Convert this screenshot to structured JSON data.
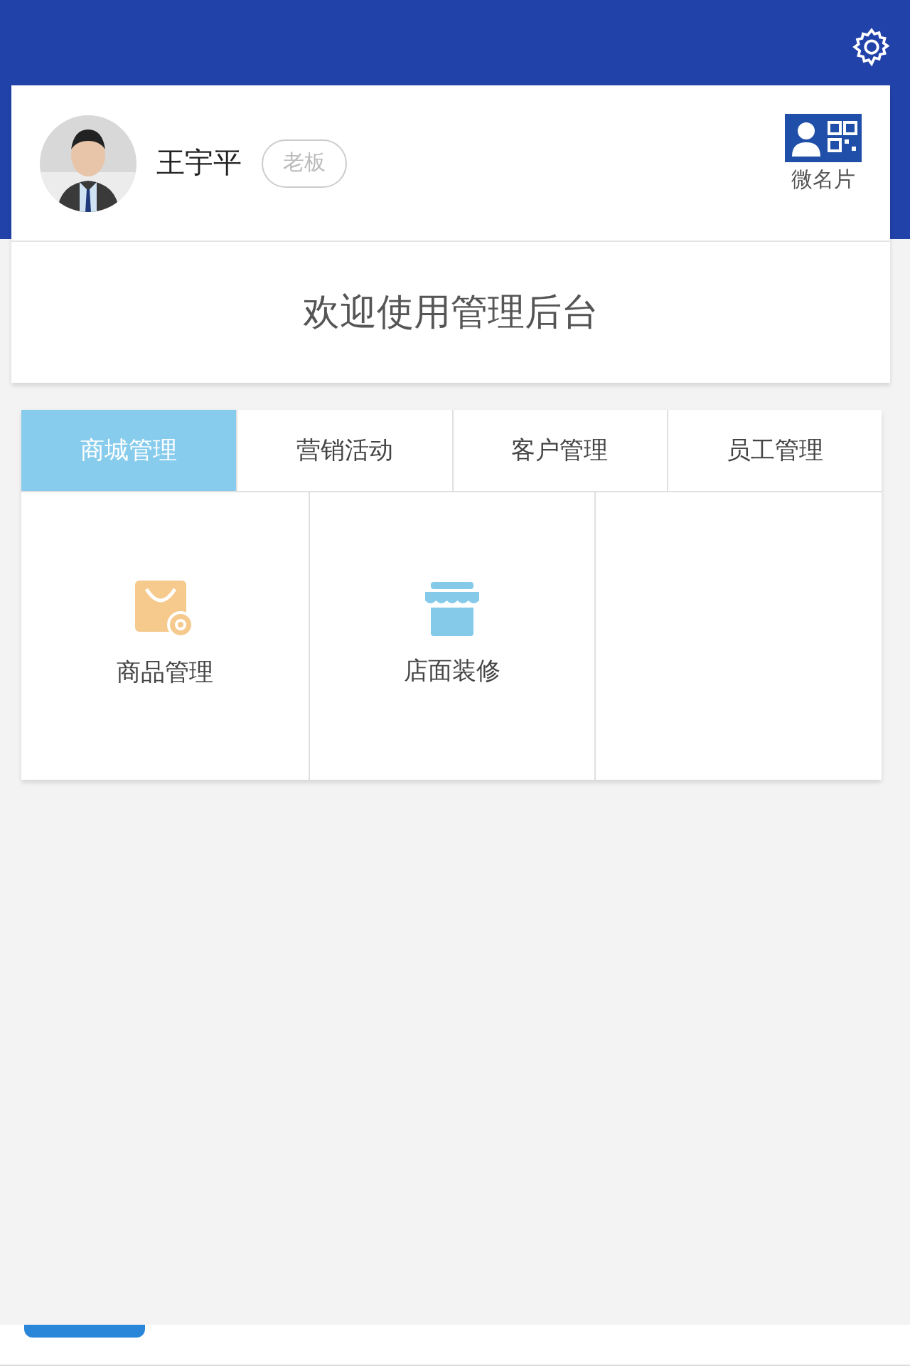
{
  "profile": {
    "name": "王宇平",
    "role": "老板",
    "card_label": "微名片"
  },
  "welcome": "欢迎使用管理后台",
  "tabs": [
    {
      "label": "商城管理",
      "selected": true
    },
    {
      "label": "营销活动",
      "selected": false
    },
    {
      "label": "客户管理",
      "selected": false
    },
    {
      "label": "员工管理",
      "selected": false
    }
  ],
  "tiles": [
    {
      "kind": "goods",
      "label": "商品管理"
    },
    {
      "kind": "store",
      "label": "店面装修"
    }
  ]
}
